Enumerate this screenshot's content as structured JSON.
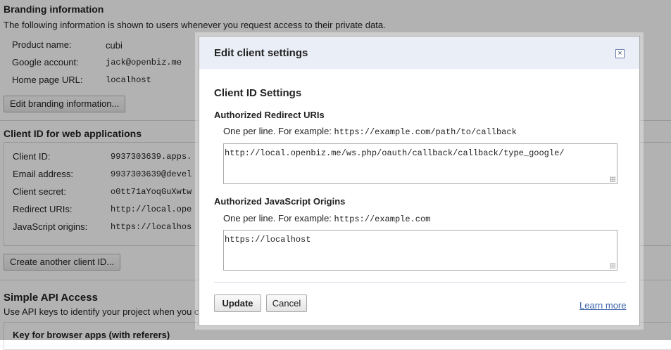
{
  "background": {
    "branding": {
      "title": "Branding information",
      "description": "The following information is shown to users whenever you request access to their private data.",
      "rows": [
        {
          "label": "Product name:",
          "value": "cubi"
        },
        {
          "label": "Google account:",
          "value": "jack@openbiz.me"
        },
        {
          "label": "Home page URL:",
          "value": "localhost"
        }
      ],
      "edit_button": "Edit branding information..."
    },
    "client_id": {
      "title": "Client ID for web applications",
      "rows": [
        {
          "label": "Client ID:",
          "value": "9937303639.apps."
        },
        {
          "label": "Email address:",
          "value": "9937303639@devel"
        },
        {
          "label": "Client secret:",
          "value": "o0tt71aYoqGuXwtw"
        },
        {
          "label": "Redirect URIs:",
          "value": "http://local.ope"
        },
        {
          "label": "JavaScript origins:",
          "value": "https://localhos"
        }
      ],
      "create_button": "Create another client ID..."
    },
    "simple_api": {
      "title": "Simple API Access",
      "description": "Use API keys to identify your project when you c",
      "key_title": "Key for browser apps (with referers)"
    }
  },
  "dialog": {
    "title": "Edit client settings",
    "close_symbol": "×",
    "section_title": "Client ID Settings",
    "redirect": {
      "title": "Authorized Redirect URIs",
      "hint": "One per line. For example: ",
      "example": "https://example.com/path/to/callback",
      "value": "http://local.openbiz.me/ws.php/oauth/callback/callback/type_google/"
    },
    "origins": {
      "title": "Authorized JavaScript Origins",
      "hint": "One per line. For example: ",
      "example": "https://example.com",
      "value": "https://localhost"
    },
    "update_button": "Update",
    "cancel_button": "Cancel",
    "learn_more": "Learn more"
  }
}
